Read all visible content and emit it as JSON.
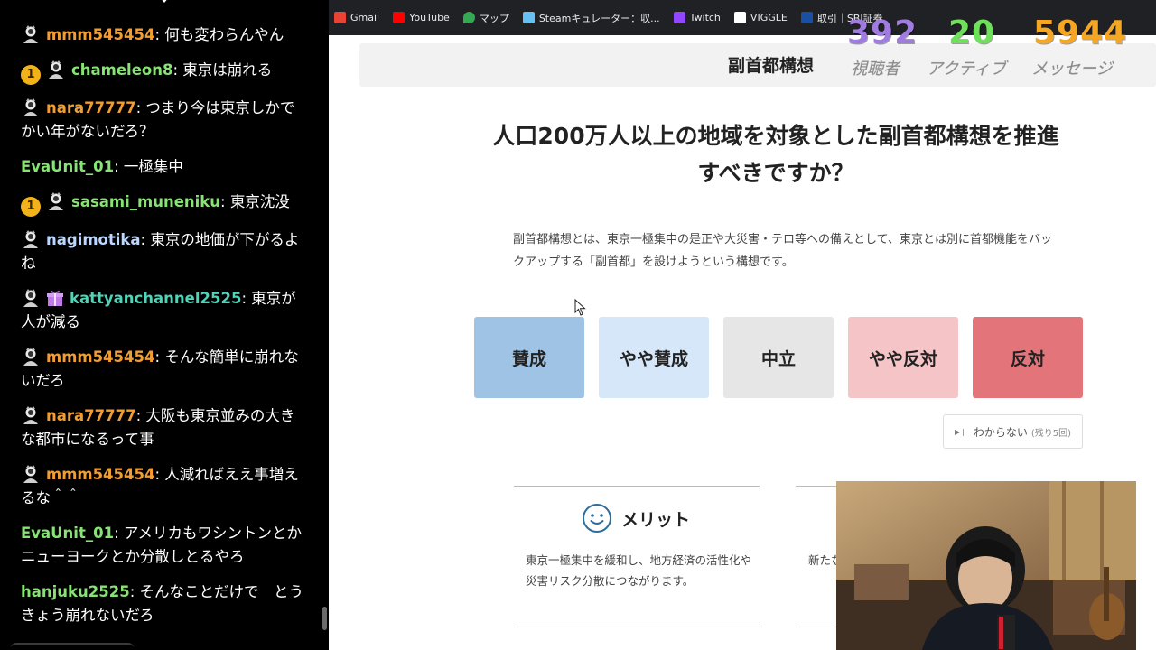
{
  "chat": {
    "messages": [
      {
        "user": "mmm545454",
        "text": ": 何も変わらんやん",
        "color": "#f29d31",
        "badge": "",
        "gift": false
      },
      {
        "user": "chameleon8",
        "text": ": 東京は崩れる",
        "color": "#87e374",
        "badge": "1",
        "gift": false
      },
      {
        "user": "nara77777",
        "text": ": つまり今は東京しかでかい年がないだろ？",
        "color": "#f29d31",
        "badge": "",
        "gift": false
      },
      {
        "user": "EvaUnit_01",
        "text": ": 一極集中",
        "color": "#87e374",
        "badge": "",
        "gift": false,
        "noavatar": true
      },
      {
        "user": "sasami_muneniku",
        "text": ": 東京沈没",
        "color": "#87e374",
        "badge": "1",
        "gift": false
      },
      {
        "user": "nagimotika",
        "text": ": 東京の地価が下がるよね",
        "color": "#bcd7ff",
        "badge": "",
        "gift": false
      },
      {
        "user": "kattyanchannel2525",
        "text": ": 東京が人が減る",
        "color": "#4fd4b8",
        "badge": "",
        "gift": true
      },
      {
        "user": "mmm545454",
        "text": ": そんな簡単に崩れないだろ",
        "color": "#f29d31",
        "badge": "",
        "gift": false
      },
      {
        "user": "nara77777",
        "text": ": 大阪も東京並みの大きな都市になるって事",
        "color": "#f29d31",
        "badge": "",
        "gift": false
      },
      {
        "user": "mmm545454",
        "text": ": 人減ればええ事増えるな＾＾",
        "color": "#f29d31",
        "badge": "",
        "gift": false
      },
      {
        "user": "EvaUnit_01",
        "text": ": アメリカもワシントンとかニューヨークとか分散しとるやろ",
        "color": "#87e374",
        "badge": "",
        "gift": false,
        "noavatar": true
      },
      {
        "user": "hanjuku2525",
        "text": ": そんなことだけで　とうきょう崩れないだろ",
        "color": "#87e374",
        "badge": "",
        "gift": false,
        "noavatar": true
      }
    ]
  },
  "bookmarks": [
    {
      "label": "Gmail",
      "icon": "gmail-icon",
      "color": "#ea4335"
    },
    {
      "label": "YouTube",
      "icon": "youtube-icon",
      "color": "#ff0000"
    },
    {
      "label": "マップ",
      "icon": "maps-icon",
      "color": "#34a853"
    },
    {
      "label": "Steamキュレーター：収...",
      "icon": "steam-icon",
      "color": "#66c0f4"
    },
    {
      "label": "Twitch",
      "icon": "twitch-icon",
      "color": "#9146ff"
    },
    {
      "label": "VIGGLE",
      "icon": "viggle-icon",
      "color": "#ffffff"
    },
    {
      "label": "取引｜SBI証券",
      "icon": "sbi-icon",
      "color": "#1a4fa3"
    }
  ],
  "stats": {
    "viewers": {
      "value": "392",
      "label": "視聴者",
      "color": "#a07be0"
    },
    "active": {
      "value": "20",
      "label": "アクティブ",
      "color": "#6fe05a"
    },
    "messages": {
      "value": "5944",
      "label": "メッセージ",
      "color": "#f5a623"
    }
  },
  "page": {
    "header_title": "副首都構想",
    "question_line1": "人口200万人以上の地域を対象とした副首都構想を推進",
    "question_line2": "すべきですか？",
    "description": "副首都構想とは、東京一極集中の是正や大災害・テロ等への備えとして、東京とは別に首都機能をバックアップする「副首都」を設けようという構想です。",
    "votes": [
      {
        "label": "賛成",
        "color": "#9ec3e4"
      },
      {
        "label": "やや賛成",
        "color": "#d5e7f8"
      },
      {
        "label": "中立",
        "color": "#e6e6e6"
      },
      {
        "label": "やや反対",
        "color": "#f4c4c7"
      },
      {
        "label": "反対",
        "color": "#e37479"
      }
    ],
    "unknown_label": "わからない",
    "unknown_remaining": "(残り5回)",
    "merit_title": "メリット",
    "merit_text": "東京一極集中を緩和し、地方経済の活性化や災害リスク分散につながります。",
    "partial_text": "新たな地域が りま"
  }
}
